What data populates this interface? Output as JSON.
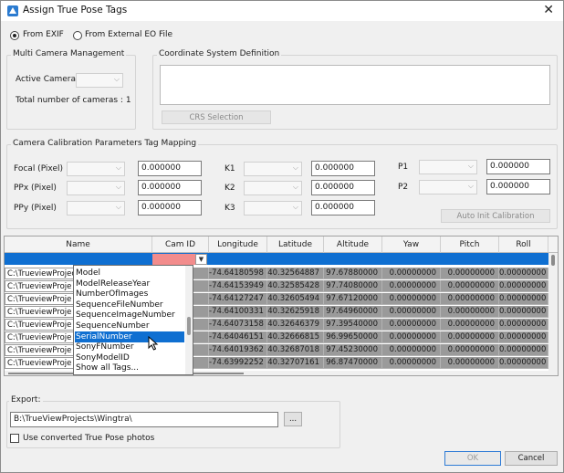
{
  "window": {
    "title": "Assign True Pose Tags"
  },
  "source": {
    "from_exif": "From EXIF",
    "from_eo": "From External EO File",
    "selected": "from_exif"
  },
  "multi_camera": {
    "title": "Multi Camera Management",
    "active_camera_label": "Active Camera",
    "active_camera_value": "",
    "total_cameras": "Total number of cameras : 1"
  },
  "crs": {
    "title": "Coordinate System Definition",
    "button": "CRS Selection"
  },
  "calibration": {
    "title": "Camera Calibration Parameters Tag Mapping",
    "rows": [
      {
        "label": "Focal (Pixel)",
        "value": "0.000000"
      },
      {
        "label": "PPx (Pixel)",
        "value": "0.000000"
      },
      {
        "label": "PPy (Pixel)",
        "value": "0.000000"
      },
      {
        "label": "K1",
        "value": "0.000000"
      },
      {
        "label": "K2",
        "value": "0.000000"
      },
      {
        "label": "K3",
        "value": "0.000000"
      },
      {
        "label": "P1",
        "value": "0.000000"
      },
      {
        "label": "P2",
        "value": "0.000000"
      }
    ],
    "auto_button": "Auto Init Calibration"
  },
  "grid": {
    "columns": [
      "Name",
      "Cam ID",
      "Longitude",
      "Latitude",
      "Altitude",
      "Yaw",
      "Pitch",
      "Roll"
    ],
    "rows": [
      {
        "name": "C:\\TrueviewProjects",
        "lon": "-74.64180598",
        "lat": "40.32564887",
        "alt": "97.67880000",
        "yaw": "0.00000000",
        "pitch": "0.00000000",
        "roll": "0.00000000"
      },
      {
        "name": "C:\\TrueviewProje",
        "lon": "-74.64153949",
        "lat": "40.32585428",
        "alt": "97.74080000",
        "yaw": "0.00000000",
        "pitch": "0.00000000",
        "roll": "0.00000000"
      },
      {
        "name": "C:\\TrueviewProje",
        "lon": "-74.64127247",
        "lat": "40.32605494",
        "alt": "97.67120000",
        "yaw": "0.00000000",
        "pitch": "0.00000000",
        "roll": "0.00000000"
      },
      {
        "name": "C:\\TrueviewProje",
        "lon": "-74.64100331",
        "lat": "40.32625918",
        "alt": "97.64960000",
        "yaw": "0.00000000",
        "pitch": "0.00000000",
        "roll": "0.00000000"
      },
      {
        "name": "C:\\TrueviewProje",
        "lon": "-74.64073158",
        "lat": "40.32646379",
        "alt": "97.39540000",
        "yaw": "0.00000000",
        "pitch": "0.00000000",
        "roll": "0.00000000"
      },
      {
        "name": "C:\\TrueviewProje",
        "lon": "-74.64046151",
        "lat": "40.32666815",
        "alt": "96.99650000",
        "yaw": "0.00000000",
        "pitch": "0.00000000",
        "roll": "0.00000000"
      },
      {
        "name": "C:\\TrueviewProje",
        "lon": "-74.64019362",
        "lat": "40.32687018",
        "alt": "97.45230000",
        "yaw": "0.00000000",
        "pitch": "0.00000000",
        "roll": "0.00000000"
      },
      {
        "name": "C:\\TrueviewProje",
        "lon": "-74.63992252",
        "lat": "40.32707161",
        "alt": "96.87470000",
        "yaw": "0.00000000",
        "pitch": "0.00000000",
        "roll": "0.00000000"
      }
    ]
  },
  "dropdown": {
    "items": [
      "Model",
      "ModelReleaseYear",
      "NumberOfImages",
      "SequenceFileNumber",
      "SequenceImageNumber",
      "SequenceNumber",
      "SerialNumber",
      "SonyFNumber",
      "SonyModelID",
      "Show all Tags..."
    ],
    "highlighted": "SerialNumber"
  },
  "export": {
    "title": "Export:",
    "path": "B:\\TrueViewProjects\\Wingtra\\",
    "browse": "...",
    "use_converted": "Use converted True Pose photos"
  },
  "buttons": {
    "ok": "OK",
    "cancel": "Cancel"
  },
  "colors": {
    "selection": "#0f6fd1",
    "invalid_cell": "#f28c8c",
    "readonly_cell": "#9a9a9a"
  }
}
